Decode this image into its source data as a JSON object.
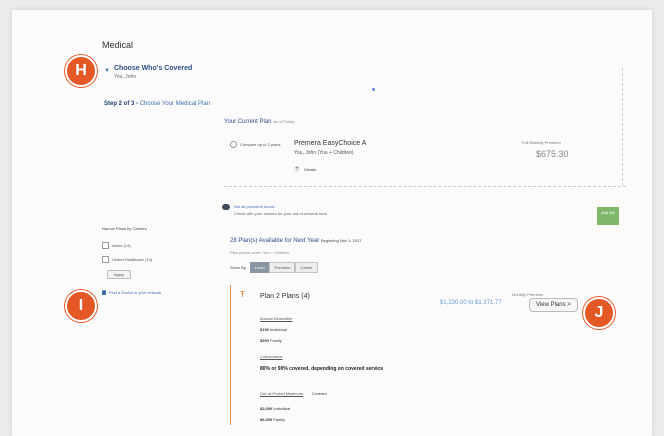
{
  "section_title": "Medical",
  "coverage": {
    "title": "Choose Who's Covered",
    "subtitle": "You, John"
  },
  "step": {
    "prefix": "Step 2 of 3 -",
    "link": "Choose Your Medical Plan"
  },
  "current_plan": {
    "heading": "Your Current Plan",
    "as_of": "As of Today",
    "compare_label": "Compare up to 3 plans",
    "plan_name": "Premera EasyChoice A",
    "coverage": "You, John (You + Children)",
    "details_label": "Details",
    "est_label": "Full Monthly Premium",
    "est_value": "$675.30"
  },
  "notice": {
    "title": "Not all providers found...",
    "subtitle": "Check with your doctors for your out-of-network fees"
  },
  "add_button": "Add Me",
  "filters": {
    "heading": "Narrow Plans by Carriers",
    "options": [
      "Aetna (14)",
      "United Healthcare (14)"
    ],
    "apply": "Apply"
  },
  "doctors_link": "Find a Doctor in your network",
  "available": {
    "title": "28 Plan(s) Available for Next Year",
    "beginning": "Beginning Nov 1, 2017",
    "for_people": "Plan prices cover: You + Children",
    "show_by_label": "Show By:",
    "show_by_options": [
      "Level",
      "Premium",
      "Carrier"
    ]
  },
  "plan_card": {
    "title": "Plan 2 Plans (4)",
    "monthly_label": "Monthly Premium",
    "monthly_range": "$1,230.00 to $1,371.77",
    "view_button": "View Plans",
    "deductible": {
      "heading": "Annual Deductible",
      "individual": "$100",
      "individual_label": "Individual",
      "family": "$300",
      "family_label": "Family"
    },
    "coinsurance": {
      "heading": "Coinsurance",
      "value": "80% or 90% covered, depending on covered service"
    },
    "oop": {
      "heading": "Out-of-Pocket Maximum",
      "extra": "Covered",
      "individual": "$2,000",
      "individual_label": "Individual",
      "family": "$6,000",
      "family_label": "Family"
    }
  },
  "markers": {
    "h": "H",
    "i": "I",
    "j": "J"
  },
  "colors": {
    "accent": "#e45826",
    "link": "#2b4f8c",
    "add_btn": "#7fb86b",
    "card_border": "#e98a54"
  }
}
